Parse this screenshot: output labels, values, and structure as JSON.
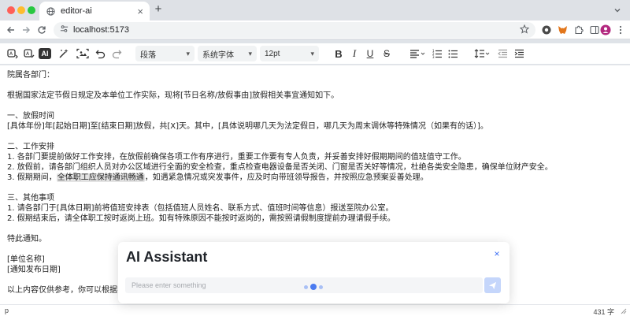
{
  "browser": {
    "tab_title": "editor-ai",
    "new_tab": "+",
    "url": "localhost:5173",
    "extensions": [
      "github-icon",
      "metamask-icon",
      "puzzle-icon",
      "profile-avatar-icon"
    ]
  },
  "toolbar": {
    "paragraph_select": "段落",
    "font_select": "系统字体",
    "size_select": "12pt",
    "bold": "B",
    "italic": "I",
    "underline": "U",
    "strike": "S",
    "ai_label": "AI"
  },
  "document": {
    "lines": [
      "院属各部门：",
      "",
      "根据国家法定节假日规定及本单位工作实际，现将[节日名称/放假事由]放假相关事宜通知如下。",
      "",
      "一、放假时间",
      "[具体年份]年[起始日期]至[结束日期]放假，共[X]天。其中，[具体说明哪几天为法定假日，哪几天为周末调休等特殊情况（如果有的话）]。",
      "",
      "二、工作安排",
      "1. 各部门要提前做好工作安排，在放假前确保各项工作有序进行，重要工作要有专人负责，并妥善安排好假期期间的值班值守工作。",
      "2. 放假前，请各部门组织人员对办公区域进行全面的安全检查，重点检查电器设备是否关闭、门窗是否关好等情况，杜绝各类安全隐患，确保单位财产安全。",
      "3. 假期期间，|全体职工应保持通讯畅通|，如遇紧急情况或突发事件，应及时向带班领导报告，并按照应急预案妥善处理。",
      "",
      "三、其他事项",
      "1. 请各部门于[具体日期]前将值班安排表（包括值班人员姓名、联系方式、值班时间等信息）报送至院办公室。",
      "2. 假期结束后，请全体职工按时返岗上班。如有特殊原因不能按时返岗的，需按照请假制度提前办理请假手续。",
      "",
      "特此通知。",
      "",
      "[单位名称]",
      "[通知发布日期]",
      "",
      "以上内容仅供参考，你可以根据实"
    ]
  },
  "statusbar": {
    "path": "p",
    "word_count": "431 字"
  },
  "ai_panel": {
    "title": "AI Assistant",
    "placeholder": "Please enter something",
    "close": "×"
  },
  "colors": {
    "accent": "#4b7bf0",
    "send_button": "#c5d6fb",
    "highlight": "#e3e3e3"
  }
}
